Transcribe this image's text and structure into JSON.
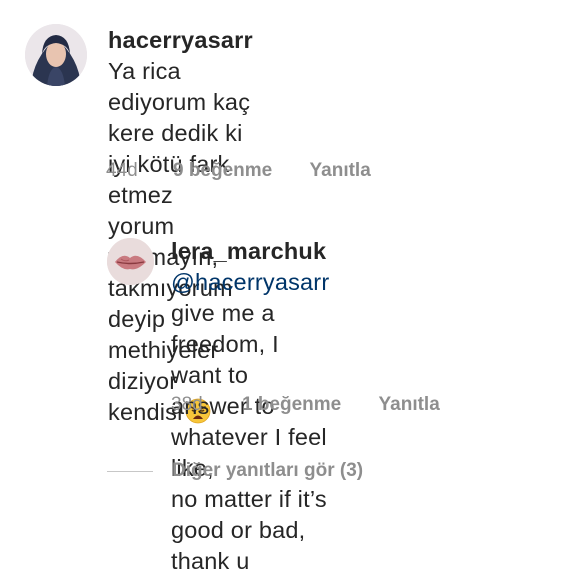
{
  "comment": {
    "username": "hacerryasarr",
    "text_lines": [
      "Ya rica ediyorum kaç",
      "kere dedik ki iyi kötü fark etmez",
      "yorum yapmayın, takmıyorum deyip",
      "methiyeler diziyor kendisi"
    ],
    "emoji_icon": "weary-face-emoji",
    "time": "44d",
    "likes": "9 beğenme",
    "reply_label": "Yanıtla"
  },
  "reply": {
    "username": "lera_marchuk",
    "mention": "@hacerryasarr",
    "text_lines": [
      "give me a freedom, I want to",
      "answer to whatever I feel like,",
      "no matter if it’s good or bad,",
      "thank u"
    ],
    "time": "38d",
    "likes": "1 beğenme",
    "reply_label": "Yanıtla"
  },
  "view_replies_label": "Diğer yanıtları gör (3)"
}
